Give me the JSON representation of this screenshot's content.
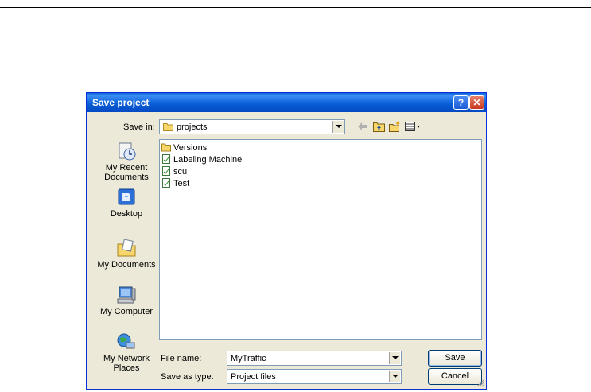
{
  "dialog": {
    "title": "Save project",
    "help_label": "?",
    "close_label": "✕"
  },
  "save_in": {
    "label": "Save in:",
    "value": "projects"
  },
  "toolbar": {
    "back_icon": "back-arrow-icon",
    "up_icon": "up-folder-icon",
    "new_folder_icon": "new-folder-icon",
    "views_icon": "views-menu-icon"
  },
  "places": [
    {
      "label": "My Recent Documents",
      "icon": "recent-documents-icon"
    },
    {
      "label": "Desktop",
      "icon": "desktop-icon"
    },
    {
      "label": "My Documents",
      "icon": "my-documents-icon"
    },
    {
      "label": "My Computer",
      "icon": "my-computer-icon"
    },
    {
      "label": "My Network Places",
      "icon": "network-places-icon"
    }
  ],
  "files": [
    {
      "name": "Versions",
      "type": "folder"
    },
    {
      "name": "Labeling Machine",
      "type": "project"
    },
    {
      "name": "scu",
      "type": "project"
    },
    {
      "name": "Test",
      "type": "project"
    }
  ],
  "file_name": {
    "label": "File name:",
    "value": "MyTraffic"
  },
  "save_as_type": {
    "label": "Save as type:",
    "value": "Project files"
  },
  "buttons": {
    "save": "Save",
    "cancel": "Cancel"
  },
  "colors": {
    "titlebar": "#0a5fd8",
    "dialog_bg": "#ece9d8",
    "border": "#7f9db9"
  }
}
